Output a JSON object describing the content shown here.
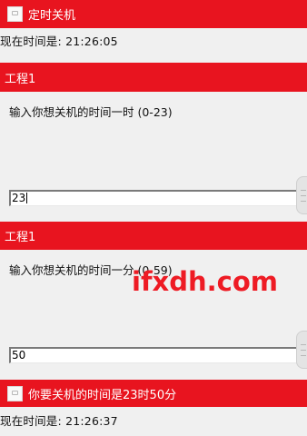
{
  "window_title": "定时关机",
  "current_time_top": "现在时间是: 21:26:05",
  "prompt_hour": {
    "title": "工程1",
    "label": "输入你想关机的时间一时 (0-23)",
    "value": "23"
  },
  "prompt_minute": {
    "title": "工程1",
    "label": "输入你想关机的时间一分 (0-59)",
    "value": "50"
  },
  "result_message": "你要关机的时间是23时50分",
  "current_time_bottom": "现在时间是: 21:26:37",
  "watermark": "ifxdh.com",
  "colors": {
    "title_bar": "#e8141f",
    "watermark": "#ee1b24"
  }
}
